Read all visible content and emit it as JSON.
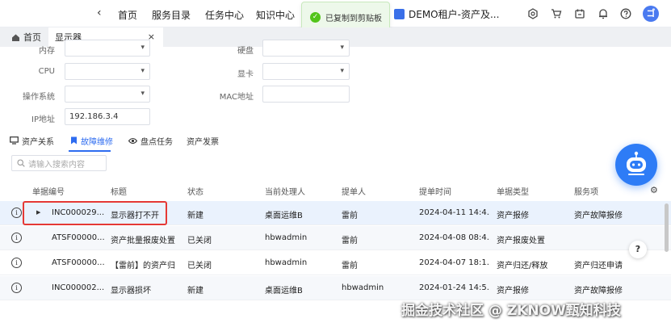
{
  "topnav": {
    "items": [
      "首页",
      "服务目录",
      "任务中心",
      "知识中心"
    ],
    "tenant": "DEMO租户-资产及...",
    "avatar": "ゴ"
  },
  "toast": {
    "text": "已复制到剪贴板"
  },
  "tabs": {
    "home": "首页",
    "active": "显示器",
    "close": "×"
  },
  "form": {
    "row0_left": "内存",
    "row0_right": "硬盘",
    "cpu_label": "CPU",
    "gpu_label": "显卡",
    "os_label": "操作系统",
    "mac_label": "MAC地址",
    "ip_label": "IP地址",
    "ip_value": "192.186.3.4"
  },
  "section_tabs": [
    {
      "label": "资产关系"
    },
    {
      "label": "故障维修"
    },
    {
      "label": "盘点任务"
    },
    {
      "label": "资产发票"
    }
  ],
  "search": {
    "placeholder": "请输入搜索内容"
  },
  "table": {
    "columns": [
      "单据编号",
      "标题",
      "状态",
      "当前处理人",
      "提单人",
      "提单时间",
      "单据类型",
      "服务项"
    ],
    "rows": [
      {
        "id": "INC000029...",
        "title": "显示器打不开",
        "status": "新建",
        "handler": "桌面运维B",
        "submitter": "雷前",
        "time": "2024-04-11 14:4...",
        "type": "资产报修",
        "service": "资产故障报修"
      },
      {
        "id": "ATSF00000...",
        "title": "资产批量报废处置",
        "status": "已关闭",
        "handler": "hbwadmin",
        "submitter": "雷前",
        "time": "2024-04-08 08:4...",
        "type": "资产报废处置",
        "service": ""
      },
      {
        "id": "ATSF00000...",
        "title": "【雷前】的资产归",
        "status": "已关闭",
        "handler": "hbwadmin",
        "submitter": "雷前",
        "time": "2024-04-07 18:1...",
        "type": "资产归还/释放",
        "service": "资产归还申请"
      },
      {
        "id": "INC000002...",
        "title": "显示器损坏",
        "status": "新建",
        "handler": "桌面运维B",
        "submitter": "hbwadmin",
        "time": "2024-01-24 14:5...",
        "type": "资产报修",
        "service": "资产故障报修"
      }
    ]
  },
  "help": "?",
  "watermark": "掘金技术社区 @ ZKNOW甄知科技",
  "colors": {
    "accent": "#2e6cf0",
    "highlight": "#e53935",
    "toast_bg": "#edf8ea",
    "success": "#52c41a"
  }
}
